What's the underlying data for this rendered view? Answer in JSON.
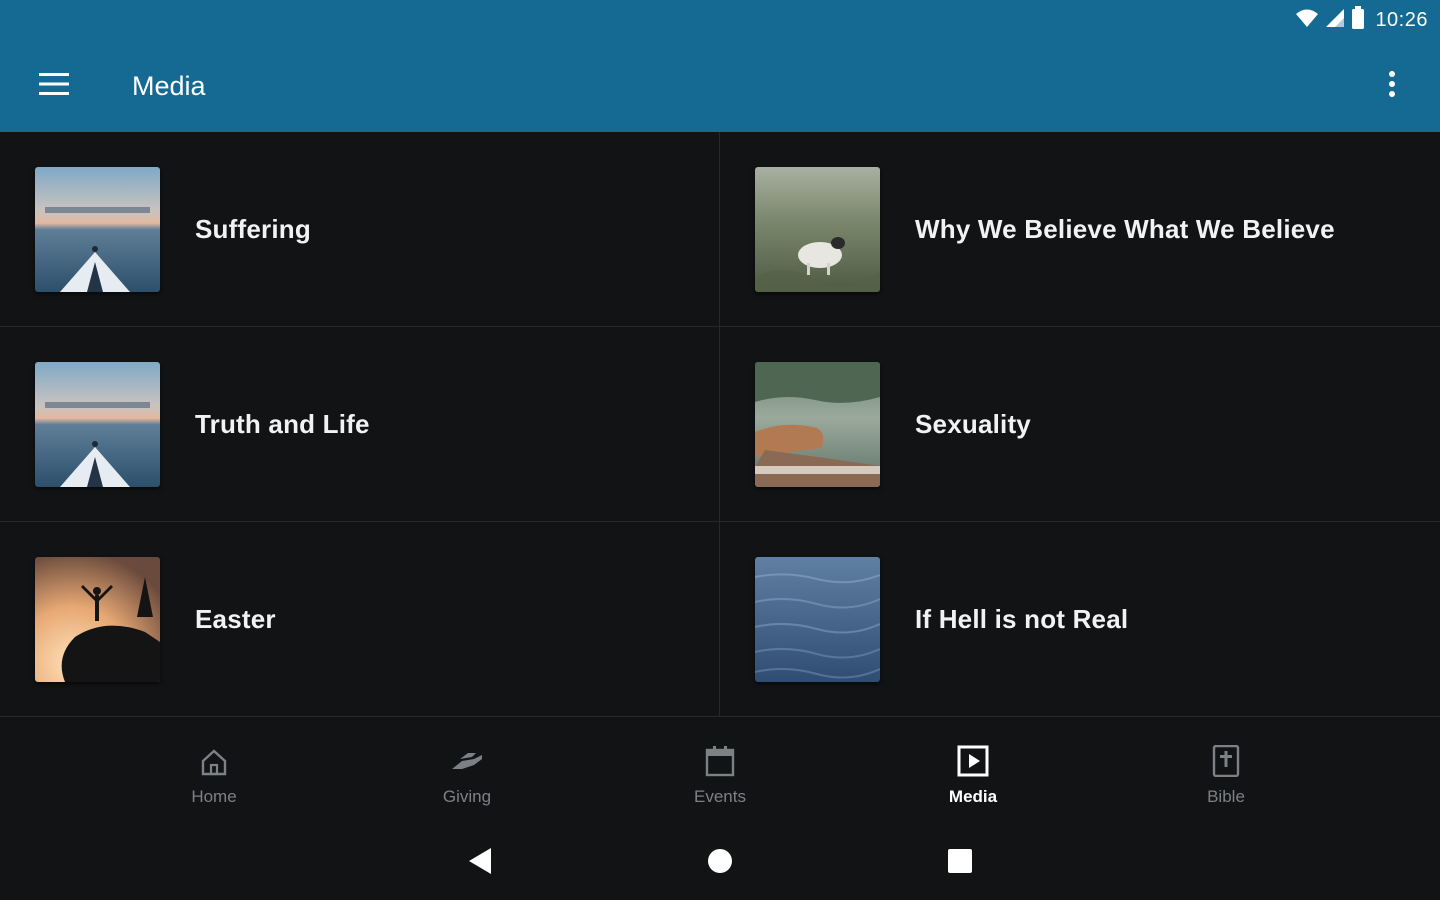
{
  "status_bar": {
    "time": "10:26",
    "icons": [
      "wifi-icon",
      "signal-icon",
      "battery-icon"
    ]
  },
  "app_bar": {
    "title": "Media",
    "menu_icon": "menu-icon",
    "overflow_icon": "more-vert-icon"
  },
  "series": [
    {
      "title": "Suffering",
      "image": "boat-lake-image"
    },
    {
      "title": "Why We Believe What We Believe",
      "image": "sheep-field-image"
    },
    {
      "title": "Truth and Life",
      "image": "boat-lake-image"
    },
    {
      "title": "Sexuality",
      "image": "hands-lake-image"
    },
    {
      "title": "Easter",
      "image": "sunset-silhouette-image"
    },
    {
      "title": "If Hell is not Real",
      "image": "water-surface-image"
    }
  ],
  "bottom_nav": {
    "items": [
      {
        "label": "Home",
        "icon": "home-icon",
        "active": false
      },
      {
        "label": "Giving",
        "icon": "giving-hand-icon",
        "active": false
      },
      {
        "label": "Events",
        "icon": "calendar-icon",
        "active": false
      },
      {
        "label": "Media",
        "icon": "play-box-icon",
        "active": true
      },
      {
        "label": "Bible",
        "icon": "bible-icon",
        "active": false
      }
    ]
  },
  "system_nav": {
    "buttons": [
      "back-icon",
      "home-circle-icon",
      "recents-icon"
    ]
  },
  "colors": {
    "primary": "#156a93",
    "background": "#121315",
    "divider": "#26282b",
    "nav_inactive": "#7d8085",
    "nav_active": "#ffffff"
  }
}
